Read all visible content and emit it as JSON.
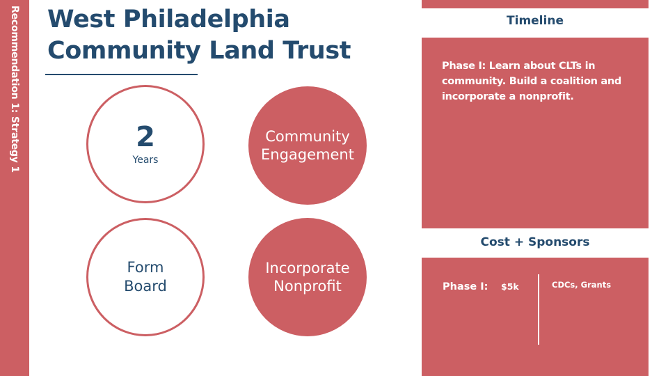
{
  "sidebar": {
    "label": "Recommendation 1: Strategy 1"
  },
  "header": {
    "title_line1": "West Philadelphia",
    "title_line2": "Community Land Trust"
  },
  "circles": {
    "duration_number": "2",
    "duration_unit": "Years",
    "engagement_line1": "Community",
    "engagement_line2": "Engagement",
    "board_line1": "Form",
    "board_line2": "Board",
    "nonprofit_line1": "Incorporate",
    "nonprofit_line2": "Nonprofit"
  },
  "timeline": {
    "heading": "Timeline",
    "text": "Phase I: Learn about CLTs in community. Build a coalition and incorporate a nonprofit."
  },
  "cost": {
    "heading": "Cost + Sponsors",
    "phase": "Phase I:",
    "amount": "$5k",
    "sponsors": "CDCs, Grants"
  },
  "colors": {
    "accent": "#cc5f63",
    "navy": "#244b6e",
    "background": "#ffffff"
  }
}
